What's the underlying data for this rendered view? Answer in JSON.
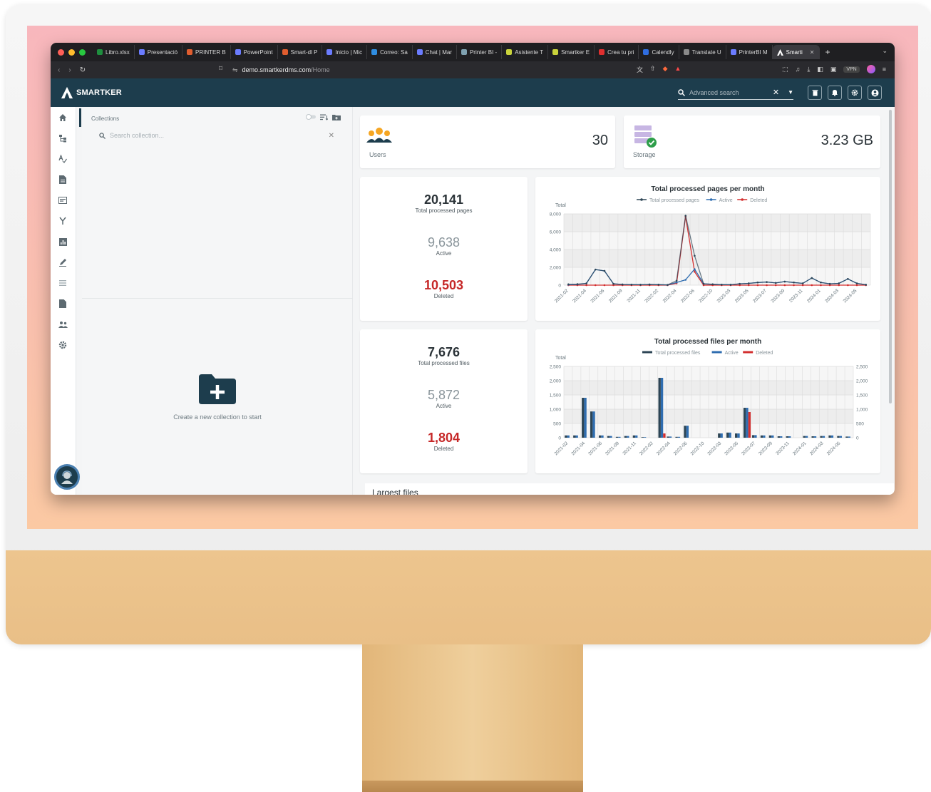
{
  "browser": {
    "tabs": [
      {
        "label": "Libro.xlsx",
        "color": "#1e8e3e"
      },
      {
        "label": "Presentació",
        "color": "#6b7cff"
      },
      {
        "label": "PRINTER B",
        "color": "#e05d2f"
      },
      {
        "label": "PowerPoint",
        "color": "#6b7cff"
      },
      {
        "label": "Smart-dl P",
        "color": "#e05d2f"
      },
      {
        "label": "Inicio | Mic",
        "color": "#6b7cff"
      },
      {
        "label": "Correo: Sa",
        "color": "#2f8de0"
      },
      {
        "label": "Chat | Mar",
        "color": "#6b7cff"
      },
      {
        "label": "Printer BI -",
        "color": "#7fa1b0"
      },
      {
        "label": "Asistente T",
        "color": "#c9d33b"
      },
      {
        "label": "Smartker E",
        "color": "#c9d33b"
      },
      {
        "label": "Crea tu pri",
        "color": "#e02f2f"
      },
      {
        "label": "Calendly",
        "color": "#2f6de0"
      },
      {
        "label": "Translate U",
        "color": "#8a8a8a"
      },
      {
        "label": "PrinterBI M",
        "color": "#6b7cff"
      }
    ],
    "active_tab": "Smarti",
    "url_host": "demo.smartkerdms.com",
    "url_path": "/Home",
    "vpn_label": "VPN"
  },
  "app": {
    "brand": "SMARTKER",
    "search_placeholder": "Advanced search"
  },
  "collections": {
    "title": "Collections",
    "search_placeholder": "Search collection...",
    "empty_text": "Create a new collection to start"
  },
  "summary": {
    "users_label": "Users",
    "users_value": "30",
    "storage_label": "Storage",
    "storage_value": "3.23 GB"
  },
  "pages": {
    "total": "20,141",
    "total_label": "Total processed pages",
    "active": "9,638",
    "active_label": "Active",
    "deleted": "10,503",
    "deleted_label": "Deleted"
  },
  "files": {
    "total": "7,676",
    "total_label": "Total processed files",
    "active": "5,872",
    "active_label": "Active",
    "deleted": "1,804",
    "deleted_label": "Deleted"
  },
  "largest_files_title": "Largest files",
  "colors": {
    "header": "#1d3d4d",
    "total_series": "#2d4555",
    "active_series": "#2f6db0",
    "deleted_series": "#d32f2f"
  },
  "chart_data": [
    {
      "type": "line",
      "title": "Total processed pages per month",
      "ylabel": "Total",
      "ylim": [
        0,
        8000
      ],
      "yticks": [
        0,
        2000,
        4000,
        6000,
        8000
      ],
      "ytick_labels": [
        "0",
        "2,000",
        "4,000",
        "6,000",
        "8,000"
      ],
      "grid": true,
      "legend": "top-center",
      "xtick_labels": [
        "2021-02",
        "2021-04",
        "2021-06",
        "2021-09",
        "2021-11",
        "2022-02",
        "2022-04",
        "2022-06",
        "2022-10",
        "2023-03",
        "2023-05",
        "2023-07",
        "2023-09",
        "2023-11",
        "2024-01",
        "2024-03",
        "2024-05"
      ],
      "x_count": 34,
      "series": [
        {
          "name": "Total processed pages",
          "values": [
            100,
            120,
            200,
            1750,
            1600,
            150,
            80,
            60,
            50,
            80,
            60,
            30,
            500,
            7800,
            3300,
            150,
            100,
            60,
            50,
            150,
            200,
            300,
            350,
            250,
            400,
            300,
            200,
            800,
            300,
            150,
            200,
            700,
            200,
            50
          ]
        },
        {
          "name": "Active",
          "values": [
            50,
            80,
            200,
            1750,
            1600,
            150,
            80,
            60,
            50,
            80,
            60,
            30,
            300,
            600,
            1800,
            150,
            100,
            60,
            50,
            150,
            200,
            300,
            350,
            250,
            400,
            300,
            200,
            800,
            300,
            150,
            200,
            700,
            200,
            50
          ]
        },
        {
          "name": "Deleted",
          "values": [
            0,
            0,
            0,
            0,
            0,
            0,
            0,
            0,
            0,
            0,
            0,
            0,
            200,
            7700,
            1500,
            0,
            0,
            0,
            0,
            0,
            0,
            0,
            0,
            0,
            0,
            0,
            0,
            0,
            0,
            0,
            0,
            0,
            0,
            0
          ]
        }
      ]
    },
    {
      "type": "bar",
      "title": "Total processed files per month",
      "ylabel": "Total",
      "ylim": [
        0,
        2500
      ],
      "yticks": [
        0,
        500,
        1000,
        1500,
        2000,
        2500
      ],
      "ytick_labels": [
        "0",
        "500",
        "1,000",
        "1,500",
        "2,000",
        "2,500"
      ],
      "grid": true,
      "legend": "top-center",
      "xtick_labels": [
        "2021-02",
        "2021-04",
        "2021-06",
        "2021-09",
        "2021-11",
        "2022-02",
        "2022-04",
        "2022-06",
        "2022-10",
        "2023-03",
        "2023-05",
        "2023-07",
        "2023-09",
        "2023-11",
        "2024-01",
        "2024-03",
        "2024-05"
      ],
      "x_count": 34,
      "series": [
        {
          "name": "Total processed files",
          "values": [
            80,
            80,
            1400,
            920,
            80,
            60,
            30,
            60,
            80,
            20,
            0,
            2100,
            40,
            30,
            420,
            0,
            0,
            0,
            150,
            180,
            150,
            1050,
            90,
            80,
            80,
            50,
            50,
            0,
            60,
            50,
            60,
            80,
            60,
            40
          ]
        },
        {
          "name": "Active",
          "values": [
            80,
            80,
            1400,
            920,
            80,
            60,
            30,
            60,
            80,
            20,
            0,
            2100,
            40,
            30,
            420,
            0,
            0,
            0,
            150,
            180,
            150,
            1050,
            90,
            80,
            80,
            50,
            50,
            0,
            60,
            50,
            60,
            80,
            60,
            40
          ]
        },
        {
          "name": "Deleted",
          "values": [
            0,
            0,
            0,
            0,
            0,
            0,
            0,
            0,
            0,
            0,
            0,
            150,
            0,
            0,
            0,
            0,
            0,
            0,
            0,
            0,
            0,
            900,
            0,
            0,
            0,
            0,
            0,
            0,
            0,
            0,
            0,
            0,
            0,
            0
          ]
        }
      ]
    }
  ]
}
